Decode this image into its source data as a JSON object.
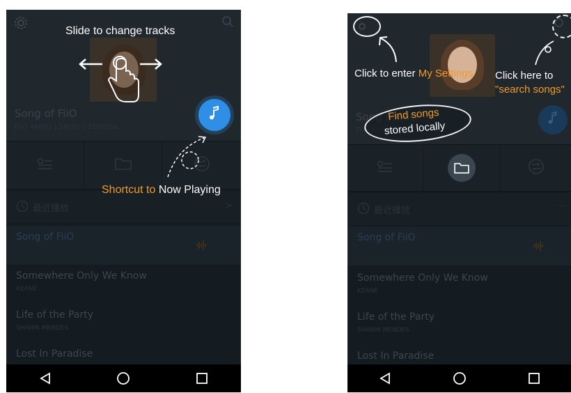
{
  "colors": {
    "accent_blue": "#2f8fe6",
    "highlight_orange": "#f29a2e",
    "overlay_text": "#ffffff",
    "background_dark": "#141c22"
  },
  "left": {
    "callout_slide": "Slide to change tracks",
    "callout_shortcut_orange": "Shortcut to ",
    "callout_shortcut_white": "Now Playing",
    "now_playing": {
      "title": "Song of FiiO",
      "meta": "FiiO 44KHz | 16bits | 320Kbps"
    },
    "recent_label": "最近播放",
    "more_label": ">",
    "songs": [
      {
        "name": "Song of FiiO",
        "artist": ""
      },
      {
        "name": "Somewhere Only We Know",
        "artist": "KEANE"
      },
      {
        "name": "Life of the Party",
        "artist": "SHAWN MENDES"
      },
      {
        "name": "Lost In Paradise",
        "artist": ""
      }
    ]
  },
  "right": {
    "callout_settings_white": "Click to enter ",
    "callout_settings_orange": "My Settings",
    "callout_search_line1": "Click here to",
    "callout_search_line2": "\"search songs\"",
    "callout_local_line1": "Find songs",
    "callout_local_line2": "stored locally",
    "now_playing": {
      "title": "Song of FiiO",
      "meta": "FiiO 44KHz"
    },
    "recent_label": "最近播放",
    "more_label": "···",
    "songs": [
      {
        "name": "Song of FiiO",
        "artist": ""
      },
      {
        "name": "Somewhere Only We Know",
        "artist": "KEANE"
      },
      {
        "name": "Life of the Party",
        "artist": "SHAWN MENDES"
      },
      {
        "name": "Lost In Paradise",
        "artist": ""
      }
    ]
  },
  "icons": [
    "gear-icon",
    "search-icon",
    "music-note-icon",
    "folder-icon",
    "equalizer-list-icon",
    "shuffle-icon",
    "clock-icon",
    "waveform-icon",
    "nav-back-icon",
    "nav-home-icon",
    "nav-recents-icon",
    "swipe-hand-icon"
  ]
}
